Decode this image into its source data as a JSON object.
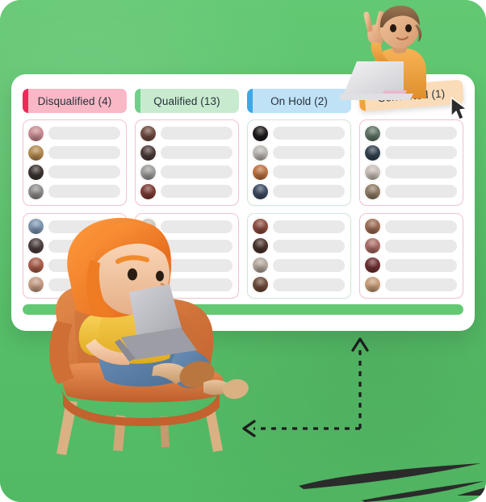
{
  "background": {
    "color": "#5cc46e"
  },
  "board": {
    "tabs": [
      {
        "label": "Disqualified (4)",
        "accent": "#f0295a",
        "fill": "#f9b8c6",
        "count": 4,
        "tilted": false
      },
      {
        "label": "Qualified (13)",
        "accent": "#6fcf8a",
        "fill": "#c8ebcf",
        "count": 13,
        "tilted": false
      },
      {
        "label": "On Hold (2)",
        "accent": "#3ea8e6",
        "fill": "#bfe2f7",
        "count": 2,
        "tilted": false
      },
      {
        "label": "Converted (1)",
        "accent": "#f0a33c",
        "fill": "#fbdcb8",
        "count": 1,
        "tilted": true
      }
    ],
    "columns": [
      {
        "name": "disqualified-column",
        "cards": [
          {
            "border": "#f3c2ce",
            "rows": [
              {
                "avatar": "avatar-woman-pink",
                "color": "#c98a92"
              },
              {
                "avatar": "avatar-woman-blonde",
                "color": "#b4894f"
              },
              {
                "avatar": "avatar-man-dark",
                "color": "#3c3330"
              },
              {
                "avatar": "avatar-man-grey",
                "color": "#8d8b8a"
              }
            ]
          },
          {
            "border": "#f3c2ce",
            "rows": [
              {
                "avatar": "avatar-man-blue-shirt",
                "color": "#7c93ad"
              },
              {
                "avatar": "avatar-person-dark",
                "color": "#4a3f3c"
              },
              {
                "avatar": "avatar-woman-red",
                "color": "#a85b48"
              },
              {
                "avatar": "avatar-woman-hat",
                "color": "#c39a82"
              }
            ]
          }
        ]
      },
      {
        "name": "qualified-column",
        "cards": [
          {
            "border": "#f3c2ce",
            "rows": [
              {
                "avatar": "avatar-woman-brown",
                "color": "#6d4a3f"
              },
              {
                "avatar": "avatar-woman-dark-hair",
                "color": "#4b3b38"
              },
              {
                "avatar": "avatar-person-grey",
                "color": "#9b9a98"
              },
              {
                "avatar": "avatar-woman-curly",
                "color": "#7a3a33"
              }
            ]
          },
          {
            "border": "#f3c2ce",
            "rows": [
              {
                "avatar": "avatar-light-portrait",
                "color": "#c9c4bd"
              },
              {
                "avatar": "avatar-man-beard",
                "color": "#8a7a63"
              },
              {
                "avatar": "avatar-man-dark-2",
                "color": "#3a322f"
              },
              {
                "avatar": "avatar-person-grey-2",
                "color": "#a5a3a0"
              }
            ]
          }
        ]
      },
      {
        "name": "on-hold-column",
        "cards": [
          {
            "border": "#cfe8d6",
            "rows": [
              {
                "avatar": "avatar-silhouette",
                "color": "#1d1a19"
              },
              {
                "avatar": "avatar-man-light",
                "color": "#b9b5b1"
              },
              {
                "avatar": "avatar-woman-orange",
                "color": "#b9703f"
              },
              {
                "avatar": "avatar-man-navy",
                "color": "#3b4a60"
              }
            ]
          },
          {
            "border": "#cfe8d6",
            "rows": [
              {
                "avatar": "avatar-woman-smiling",
                "color": "#8a4a3c"
              },
              {
                "avatar": "avatar-woman-dark-2",
                "color": "#4a332c"
              },
              {
                "avatar": "avatar-man-cap",
                "color": "#b2a69c"
              },
              {
                "avatar": "avatar-man-brown",
                "color": "#6b4a38"
              }
            ]
          }
        ]
      },
      {
        "name": "converted-column",
        "cards": [
          {
            "border": "#f3c2ce",
            "rows": [
              {
                "avatar": "avatar-man-green",
                "color": "#5f7264"
              },
              {
                "avatar": "avatar-man-suit",
                "color": "#33414f"
              },
              {
                "avatar": "avatar-person-pale",
                "color": "#c6bdb4"
              },
              {
                "avatar": "avatar-woman-long-hair",
                "color": "#8e7a63"
              }
            ]
          },
          {
            "border": "#f3c2ce",
            "rows": [
              {
                "avatar": "avatar-woman-brunette",
                "color": "#9b6a52"
              },
              {
                "avatar": "avatar-woman-pink-2",
                "color": "#a86a63"
              },
              {
                "avatar": "avatar-woman-maroon",
                "color": "#6e2f30"
              },
              {
                "avatar": "avatar-woman-blonde-2",
                "color": "#c49a74"
              }
            ]
          }
        ]
      }
    ],
    "footer_bar": {
      "name": "progress-bar",
      "fill_percent": 100,
      "track_color": "#e6f4e7",
      "fill_color": "#63c873"
    }
  },
  "annotations": {
    "arrow": {
      "name": "dashed-callout-arrow",
      "color": "#1d1d1d",
      "style": "dashed-elbow-double-arrow"
    },
    "scribble": {
      "name": "brush-scribble",
      "color": "#2b2b2b"
    },
    "cursor": {
      "name": "mouse-cursor",
      "color": "#2b2b2b"
    }
  },
  "illustrations": {
    "seated_woman": {
      "name": "3d-woman-on-armchair-with-laptop",
      "hair": "#f07d2a",
      "shirt": "#f5c842",
      "jeans": "#5b7fa6",
      "chair": "#d4733a",
      "laptop": "#b9b9be",
      "legs": "#d8b08c"
    },
    "peace_person": {
      "name": "3d-person-peace-sign-with-laptop",
      "hair": "#8a6a4a",
      "shirt": "#f5a742",
      "skin": "#e8b48a",
      "laptop": "#e2e2e4"
    }
  }
}
